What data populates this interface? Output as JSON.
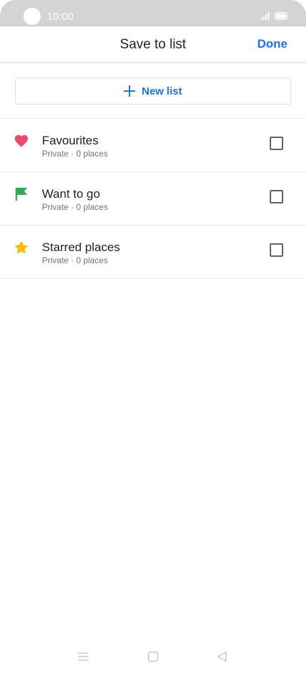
{
  "status_bar": {
    "time": "10:00",
    "icons": [
      "camera-cutout",
      "signal-icon",
      "battery-icon"
    ]
  },
  "header": {
    "title": "Save to list",
    "done_label": "Done"
  },
  "new_list": {
    "label": "New list",
    "icon": "plus-icon"
  },
  "lists": [
    {
      "name": "Favourites",
      "subtitle": "Private · 0 places",
      "icon": "heart-icon",
      "icon_color": "#ea4c6f",
      "checked": false
    },
    {
      "name": "Want to go",
      "subtitle": "Private · 0 places",
      "icon": "flag-icon",
      "icon_color": "#34a853",
      "checked": false
    },
    {
      "name": "Starred places",
      "subtitle": "Private · 0 places",
      "icon": "star-icon",
      "icon_color": "#fbbc04",
      "checked": false
    }
  ],
  "nav_bar": {
    "buttons": [
      "menu-icon",
      "home-icon",
      "back-icon"
    ]
  },
  "colors": {
    "accent": "#1a73e8",
    "status_bar_bg": "#d4d4d4",
    "divider": "#e6e6e6"
  }
}
